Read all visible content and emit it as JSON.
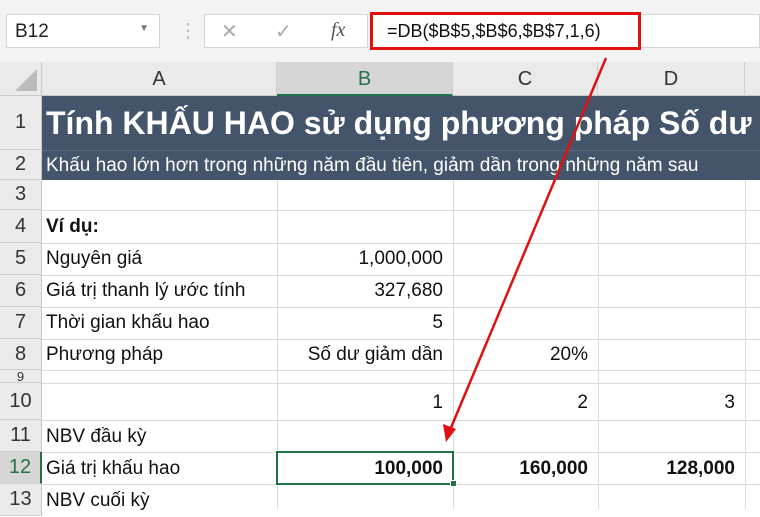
{
  "formula_bar": {
    "name_box": "B12",
    "cancel_icon": "✕",
    "enter_icon": "✓",
    "fx_label": "fx",
    "formula": "=DB($B$5,$B$6,$B$7,1,6)"
  },
  "columns": [
    "A",
    "B",
    "C",
    "D"
  ],
  "rows": [
    "1",
    "2",
    "3",
    "4",
    "5",
    "6",
    "7",
    "8",
    "9",
    "10",
    "11",
    "12",
    "13"
  ],
  "title": "Tính KHẤU HAO sử dụng phương pháp Số dư giảm dần",
  "subtitle": "Khấu hao lớn hơn trong những năm đầu tiên, giảm dần trong những năm sau",
  "example_label": "Ví dụ:",
  "labels": {
    "cost": "Nguyên giá",
    "salvage": "Giá trị thanh lý ước tính",
    "life": "Thời gian khấu hao",
    "method": "Phương pháp",
    "nbv_start": "NBV đầu kỳ",
    "depreciation": "Giá trị khấu hao",
    "nbv_end": "NBV cuối kỳ"
  },
  "values": {
    "cost": "1,000,000",
    "salvage": "327,680",
    "life": "5",
    "method": "Số dư giảm dần",
    "rate": "20%"
  },
  "years": [
    "1",
    "2",
    "3"
  ],
  "depreciation": [
    "100,000",
    "160,000",
    "128,000"
  ],
  "accent": "#217346",
  "banner_color": "#44546a",
  "highlight": "#e01010"
}
